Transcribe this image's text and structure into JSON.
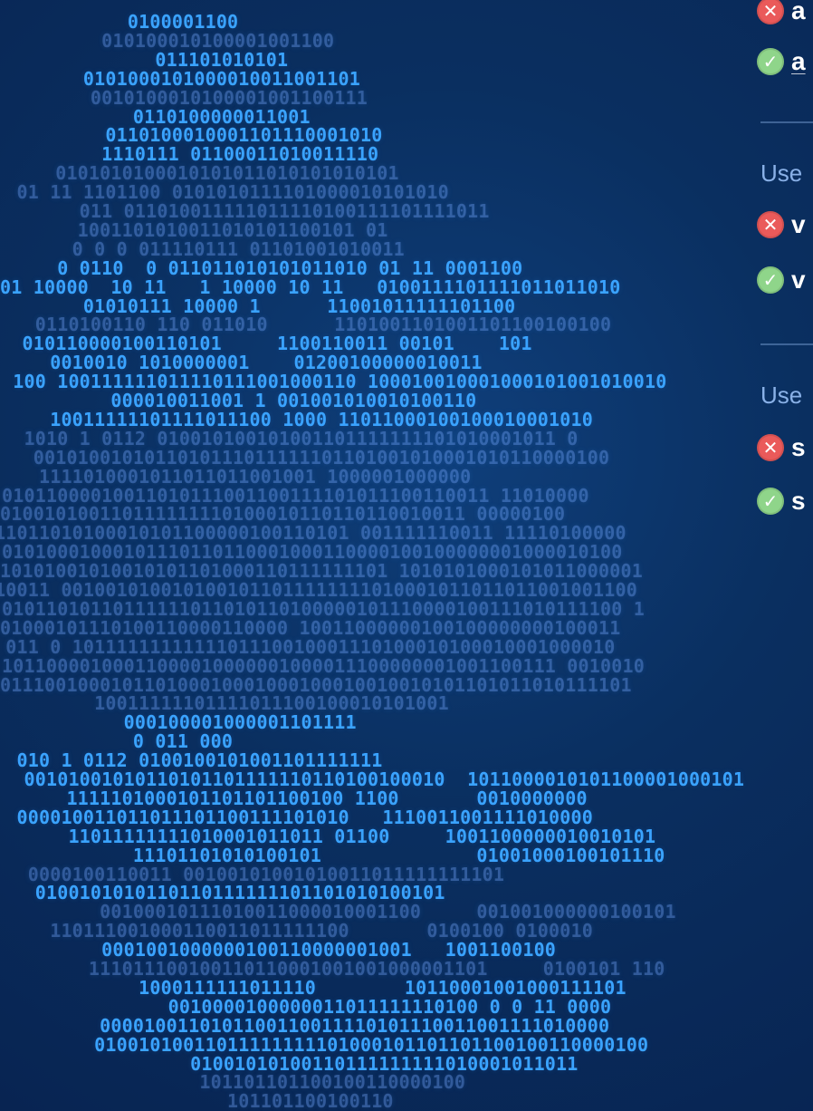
{
  "background": {
    "colors": {
      "base": "#0b2f5e",
      "binary_dim": "#1a3f77",
      "binary_mid": "#3aa3ff",
      "binary_bright": "#eaf6ff"
    },
    "binary_art": {
      "lines": [
        {
          "t": "            0100001100",
          "c": "b2"
        },
        {
          "t": "         010100010100001001100",
          "c": "b1"
        },
        {
          "t": "              011101010101",
          "c": "b2"
        },
        {
          "t": "        0101000101000010011001101",
          "c": "b2"
        },
        {
          "t": "        0010100010100001001100111",
          "c": "b1"
        },
        {
          "t": "            0110100000011001",
          "c": "b2"
        },
        {
          "t": "          0110100010001101110001010",
          "c": "b2"
        },
        {
          "t": "         1110111 01100011010011110",
          "c": "b2"
        },
        {
          "t": "     0101010100010101011010101010101",
          "c": "b1"
        },
        {
          "t": "  01 11 1101100 0101010111101000010101010",
          "c": "b1"
        },
        {
          "t": "       011 011010011111011110100111101111011",
          "c": "b1"
        },
        {
          "t": "       1001101010011010101100101 01",
          "c": "b1"
        },
        {
          "t": "       0 0 0 011110111 01101001010011",
          "c": "b1"
        },
        {
          "t": "     0 0110  0 011011010101011010 01 11 0001100",
          "c": "b2"
        },
        {
          "t": "01 10000  10 11   1 10000 10 11   0100111101111011011010",
          "c": "b2"
        },
        {
          "t": "        01010111 10000 1      11001011111101100",
          "c": "b2"
        },
        {
          "t": "   0110100110 110 011010      1101001101001101100100100",
          "c": "b1"
        },
        {
          "t": "  010110000100110101     1100110011 00101    101",
          "c": "b2"
        },
        {
          "t": "     0010010 1010000001    01200100000010011",
          "c": "b2"
        },
        {
          "t": " 100 100111111011110111001000110 100010010001000101001010010",
          "c": "b2"
        },
        {
          "t": "          000010011001 1 001001010010100110",
          "c": "b2"
        },
        {
          "t": "     10011111101111011100 1000 11011000100100010001010",
          "c": "b2"
        },
        {
          "t": "  1010 1 0112 010010100101001101111111101010001011 0",
          "c": "b1"
        },
        {
          "t": "   0010100101011010111011111101101001010001010110000100",
          "c": "b1"
        },
        {
          "t": "    1111010001011011011001001 1000001000000",
          "c": "b1"
        },
        {
          "t": "01011000010011010111001100111101011100110011 11010000",
          "c": "b1"
        },
        {
          "t": "010010100110111111110100010110110110010011 00000100",
          "c": "b1"
        },
        {
          "t": "11011010100010101100000100110101 001111110011 11110100000",
          "c": "b1"
        },
        {
          "t": "01010001000101110110110001000110000100100000001000010100",
          "c": "b1"
        },
        {
          "t": "10101001010010101101000110111111101 1010101000101011000001",
          "c": "b1"
        },
        {
          "t": "10011 0010010100101001011011111111010001011011011001001100",
          "c": "b1"
        },
        {
          "t": "01011010110111111011010110100000101110000100111010111100 1",
          "c": "b1"
        },
        {
          "t": "01000101110100110000110000 10011000000100100000000100011",
          "c": "b1"
        },
        {
          "t": " 011 0 1011111111111101110010001110100010100010001000010",
          "c": "b1"
        },
        {
          "t": "10110000100011000010000001000011100000001001100111 0010010",
          "c": "b1"
        },
        {
          "t": "011100100010110100010001000100010010010101101011010111101",
          "c": "b1"
        },
        {
          "t": "         10011111101111011100100010101001",
          "c": "b1"
        },
        {
          "t": "           000100001000001101111",
          "c": "b2"
        },
        {
          "t": "            0 011 000",
          "c": "b2"
        },
        {
          "t": "  010 1 0112 0100100101001101111111",
          "c": "b2"
        },
        {
          "t": "  00101001010110101101111110110100100010  1011000010101100001000101",
          "c": "b2"
        },
        {
          "t": "      1111101000101101101100100 1100       0010000000",
          "c": "b2"
        },
        {
          "t": "  000010011011011101100111101010   1110011001111010000",
          "c": "b2"
        },
        {
          "t": "      11011111111010001011011 01100     1001100000010010101",
          "c": "b2"
        },
        {
          "t": "            11101101010100101              01001000100101110",
          "c": "b2"
        },
        {
          "t": "   0000100110011 00100101001010011011111111101",
          "c": "b1"
        },
        {
          "t": "   0100101010110110111111101101010100101",
          "c": "b2"
        },
        {
          "t": "         00100010111010011000010001100     001001000000100101",
          "c": "b1"
        },
        {
          "t": "     110111001000110011011111100       0100100 0100010",
          "c": "b1"
        },
        {
          "t": "         0001001000000100110000001001   1001100100",
          "c": "b2"
        },
        {
          "t": "        111011100100110110001001001000001101     0100101 110",
          "c": "b1"
        },
        {
          "t": "             1000111111011110        10110001001000111101",
          "c": "b2"
        },
        {
          "t": "               0010000100000011011111110100 0 0 11 0000",
          "c": "b2"
        },
        {
          "t": "         0000100110101100110011110101110011001111010000",
          "c": "b2"
        },
        {
          "t": "         01001010011011111111101000101101101100100110000100",
          "c": "b2"
        },
        {
          "t": "                 01001010100110111111111010001011011",
          "c": "b2"
        },
        {
          "t": "                  101101101100100110000100",
          "c": "b1"
        },
        {
          "t": "                     101101100100110",
          "c": "b1"
        }
      ]
    }
  },
  "right_panel": {
    "items": [
      {
        "type": "row",
        "status": "bad",
        "icon": "x",
        "text": "a"
      },
      {
        "type": "row",
        "status": "good",
        "icon": "check",
        "text": "a",
        "underline": true
      },
      {
        "type": "label",
        "text": "Use"
      },
      {
        "type": "row",
        "status": "bad",
        "icon": "x",
        "text": "v"
      },
      {
        "type": "row",
        "status": "good",
        "icon": "check",
        "text": "v"
      },
      {
        "type": "label",
        "text": "Use"
      },
      {
        "type": "row",
        "status": "bad",
        "icon": "x",
        "text": "s"
      },
      {
        "type": "row",
        "status": "good",
        "icon": "check",
        "text": "s"
      }
    ]
  }
}
